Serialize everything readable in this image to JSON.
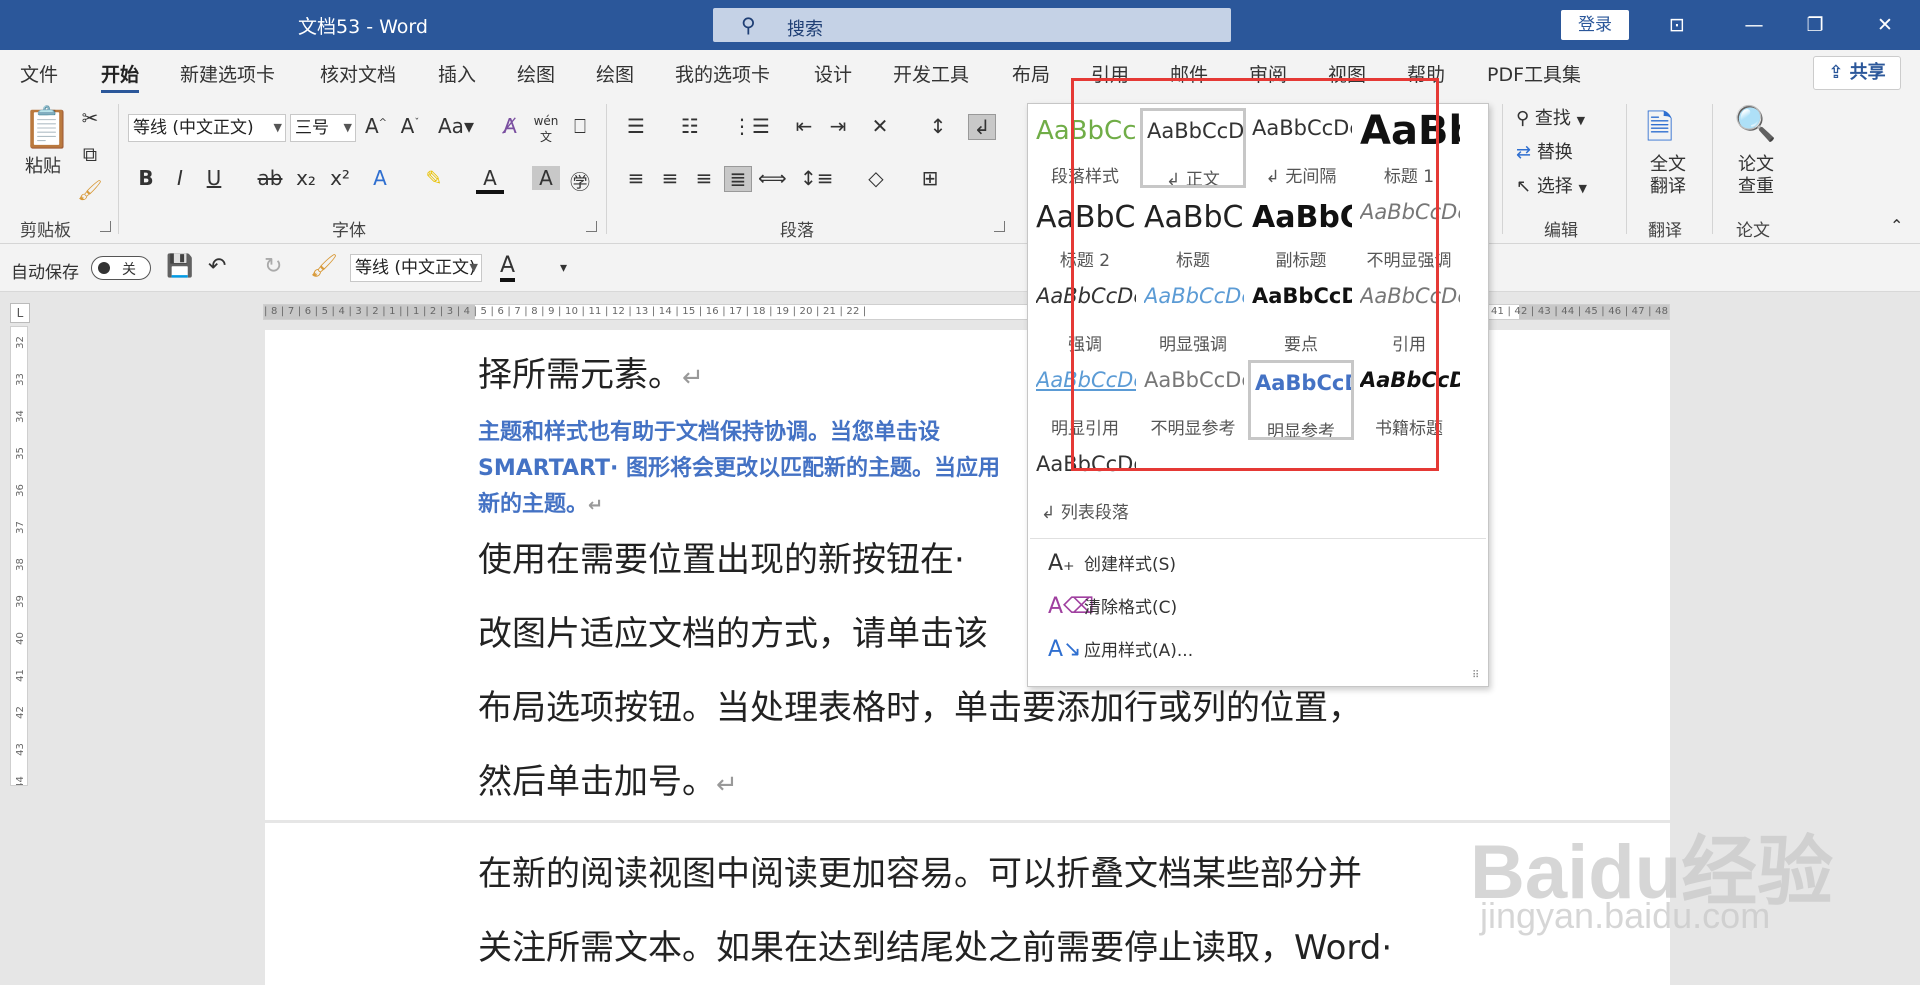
{
  "titlebar": {
    "title": "文档53  -  Word",
    "search_placeholder": "搜索",
    "login": "登录",
    "ribbon_display_glyph": "⊡",
    "minimize_glyph": "—",
    "restore_glyph": "❐",
    "close_glyph": "✕"
  },
  "menu": {
    "tabs": [
      "文件",
      "开始",
      "新建选项卡",
      "核对文档",
      "插入",
      "绘图",
      "绘图",
      "我的选项卡",
      "设计",
      "开发工具",
      "布局",
      "引用",
      "邮件",
      "审阅",
      "视图",
      "帮助",
      "PDF工具集"
    ],
    "active_index": 1,
    "share": "共享"
  },
  "ribbon": {
    "clipboard": {
      "paste": "粘贴",
      "label": "剪贴板"
    },
    "font": {
      "name": "等线 (中文正文)",
      "size": "三号",
      "label": "字体"
    },
    "paragraph": {
      "label": "段落"
    },
    "editing": {
      "find": "查找",
      "replace": "替换",
      "select": "选择",
      "label": "编辑"
    },
    "translate": {
      "button": "全文翻译",
      "label": "翻译"
    },
    "paper": {
      "button": "论文查重",
      "label": "论文"
    }
  },
  "qat": {
    "autosave": "自动保存",
    "toggle": "关",
    "font": "等线 (中文正文)"
  },
  "ruler": {
    "h_ticks": "| 8 | 7 | 6 | 5 | 4 | 3 | 2 | 1 |     | 1 | 2 | 3 | 4 | 5 | 6 | 7 | 8 | 9 | 10 | 11 | 12 | 13 | 14 | 15 | 16 | 17 | 18 | 19 | 20 | 21 | 22 |",
    "h_ticks_right": "| 41 | 42 | 43 | 44 | 45 | 46 | 47 | 48",
    "v_ticks": [
      "32",
      "33",
      "34",
      "35",
      "36",
      "37",
      "38",
      "39",
      "40",
      "41",
      "42",
      "43",
      "44"
    ]
  },
  "document": {
    "line1": "择所需元素。",
    "blue1": "主题和样式也有助于文档保持协调。当您单击设",
    "blue2": "SMARTART· 图形将会更改以匹配新的主题。当应用",
    "blue3": "新的主题。",
    "line2": "使用在需要位置出现的新按钮在·",
    "line3": "改图片适应文档的方式，请单击该",
    "line4": "布局选项按钮。当处理表格时，单击要添加行或列的位置，",
    "line5": "然后单击加号。",
    "line6": "在新的阅读视图中阅读更加容易。可以折叠文档某些部分并",
    "line7": "关注所需文本。如果在达到结尾处之前需要停止读取，Word·",
    "para_mark": "↵"
  },
  "styles": [
    {
      "sample": "AaBbCc",
      "name": "段落样式",
      "color": "#70ad47",
      "size": 26,
      "weight": "normal",
      "italic": false
    },
    {
      "sample": "AaBbCcDc",
      "name": "↲ 正文",
      "color": "#333333",
      "size": 21,
      "weight": "normal",
      "italic": false,
      "selected": true
    },
    {
      "sample": "AaBbCcDc",
      "name": "↲ 无间隔",
      "color": "#333333",
      "size": 21,
      "weight": "normal",
      "italic": false
    },
    {
      "sample": "AaBb",
      "name": "标题 1",
      "color": "#111111",
      "size": 40,
      "weight": "bold",
      "italic": false
    },
    {
      "sample": "AaBbC",
      "name": "标题 2",
      "color": "#222222",
      "size": 30,
      "weight": "normal",
      "italic": false
    },
    {
      "sample": "AaBbC",
      "name": "标题",
      "color": "#222222",
      "size": 30,
      "weight": "normal",
      "italic": false
    },
    {
      "sample": "AaBbC",
      "name": "副标题",
      "color": "#111111",
      "size": 30,
      "weight": "bold",
      "italic": false
    },
    {
      "sample": "AaBbCcDc",
      "name": "不明显强调",
      "color": "#777777",
      "size": 21,
      "weight": "normal",
      "italic": true
    },
    {
      "sample": "AaBbCcDc",
      "name": "强调",
      "color": "#333333",
      "size": 21,
      "weight": "normal",
      "italic": true
    },
    {
      "sample": "AaBbCcDc",
      "name": "明显强调",
      "color": "#5b9bd5",
      "size": 21,
      "weight": "normal",
      "italic": true
    },
    {
      "sample": "AaBbCcDc",
      "name": "要点",
      "color": "#111111",
      "size": 21,
      "weight": "bold",
      "italic": false
    },
    {
      "sample": "AaBbCcDc",
      "name": "引用",
      "color": "#777777",
      "size": 21,
      "weight": "normal",
      "italic": true
    },
    {
      "sample": "AaBbCcDc",
      "name": "明显引用",
      "color": "#5b9bd5",
      "size": 21,
      "weight": "normal",
      "italic": true,
      "underline": true
    },
    {
      "sample": "AaBbCcDc",
      "name": "不明显参考",
      "color": "#777777",
      "size": 21,
      "weight": "normal",
      "italic": false
    },
    {
      "sample": "AaBbCcD",
      "name": "明显参考",
      "color": "#4472c4",
      "size": 21,
      "weight": "bold",
      "italic": false,
      "selected": true
    },
    {
      "sample": "AaBbCcD",
      "name": "书籍标题",
      "color": "#111111",
      "size": 21,
      "weight": "bold",
      "italic": true
    },
    {
      "sample": "AaBbCcDc",
      "name": "↲ 列表段落",
      "color": "#333333",
      "size": 21,
      "weight": "normal",
      "italic": false
    }
  ],
  "styles_commands": [
    {
      "icon": "A₊",
      "label": "创建样式(S)"
    },
    {
      "icon": "A⌫",
      "label": "清除格式(C)"
    },
    {
      "icon": "A↘",
      "label": "应用样式(A)..."
    }
  ],
  "watermark": {
    "brand": "Baidu经验",
    "url": "jingyan.baidu.com"
  },
  "colors": {
    "titlebar": "#2b579a",
    "highlight_box": "#e53935"
  }
}
